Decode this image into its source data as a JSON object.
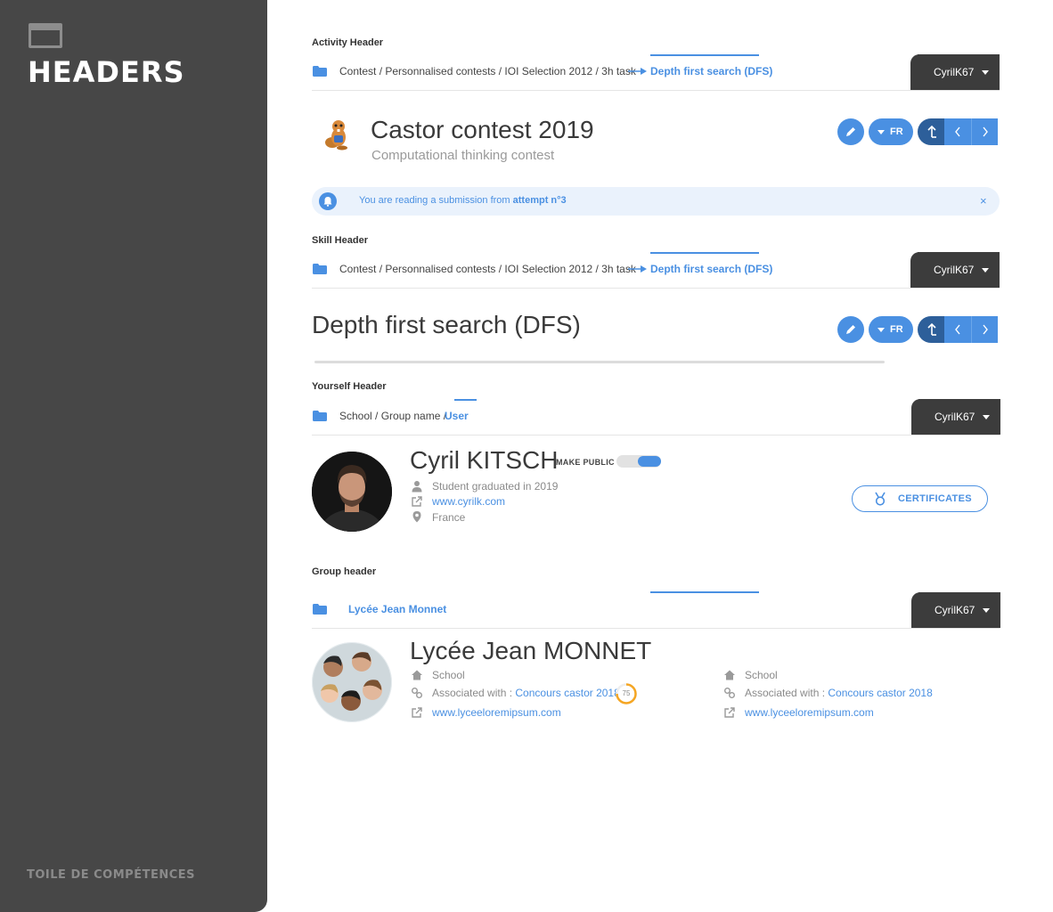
{
  "sidebar": {
    "title": "HEADERS",
    "footer": "TOILE DE COMPÉTENCES",
    "icon": "window-icon"
  },
  "activity": {
    "label": "Activity Header",
    "breadcrumb": "Contest / Personnalised contests / IOI Selection 2012 / 3h task",
    "breadcrumb_active": "Depth first search (DFS)",
    "user": "CyrilK67",
    "title": "Castor contest 2019",
    "subtitle": "Computational thinking contest",
    "lang": "FR",
    "alert_text": "You are reading a submission from ",
    "alert_bold": "attempt n°3",
    "alert_close": "×"
  },
  "skill": {
    "label": "Skill Header",
    "breadcrumb": "Contest / Personnalised contests / IOI Selection 2012 / 3h task",
    "breadcrumb_active": "Depth first search (DFS)",
    "user": "CyrilK67",
    "title": "Depth first search (DFS)",
    "lang": "FR"
  },
  "yourself": {
    "label": "Yourself Header",
    "breadcrumb": "School / Group name /",
    "breadcrumb_active": "User",
    "user": "CyrilK67",
    "name": "Cyril KITSCH",
    "make_public": "MAKE PUBLIC",
    "make_public_on": true,
    "status": "Student graduated in 2019",
    "website": "www.cyrilk.com",
    "location": "France",
    "certificates": "CERTIFICATES"
  },
  "group": {
    "label": "Group header",
    "breadcrumb_active": "Lycée Jean Monnet",
    "user": "CyrilK67",
    "name": "Lycée Jean MONNET",
    "col1": {
      "type": "School",
      "assoc_label": "Associated with : ",
      "assoc_link": "Concours castor 2018",
      "assoc_badge": "75",
      "website": "www.lyceeloremipsum.com"
    },
    "col2": {
      "type": "School",
      "assoc_label": "Associated with : ",
      "assoc_link": "Concours castor 2018",
      "website": "www.lyceeloremipsum.com"
    }
  },
  "colors": {
    "accent": "#4a90e2",
    "sidebar": "#474747",
    "user_tab": "#3c3c3c"
  }
}
